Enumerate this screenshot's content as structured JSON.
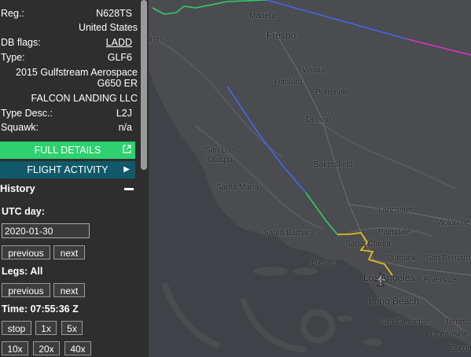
{
  "info": {
    "reg_label": "Reg.:",
    "reg_value": "N628TS",
    "country": "United States",
    "dbflags_label": "DB flags:",
    "dbflags_value": "LADD",
    "type_label": "Type:",
    "type_value": "GLF6",
    "aircraft_line1": "2015 Gulfstream Aerospace",
    "aircraft_line2": "G650 ER",
    "owner": "FALCON LANDING LLC",
    "typedesc_label": "Type Desc.:",
    "typedesc_value": "L2J",
    "squawk_label": "Squawk:",
    "squawk_value": "n/a"
  },
  "buttons": {
    "full_details": "FULL DETAILS",
    "flight_activity": "FLIGHT ACTIVITY"
  },
  "history": {
    "title": "History",
    "utc_day_label": "UTC day:",
    "utc_day_value": "2020-01-30",
    "previous": "previous",
    "next": "next",
    "legs_label": "Legs: All",
    "time_label": "Time: 07:55:36 Z",
    "stop": "stop",
    "speed_1x": "1x",
    "speed_5x": "5x",
    "speed_10x": "10x",
    "speed_20x": "20x",
    "speed_40x": "40x"
  },
  "map": {
    "cities": [
      "Madera",
      "Fresno",
      "inas",
      "Visalia",
      "Hanford",
      "Porterville",
      "Delano",
      "San Luis",
      "Obispo",
      "Bakersfield",
      "Santa Maria",
      "Lancaster",
      "Victorville",
      "Palmdale",
      "Santa Barbara",
      "Santa Clarita",
      "Oxnard",
      "Burbank",
      "San Bernard",
      "Los Angeles",
      "Riverside",
      "Long Beach",
      "San Clemente",
      "Temec",
      "Oceanside",
      "Escon"
    ],
    "colors": {
      "track_blue": "#4466ee",
      "track_green": "#33cc66",
      "track_yellow": "#f5c518",
      "track_magenta": "#dd33cc"
    }
  }
}
